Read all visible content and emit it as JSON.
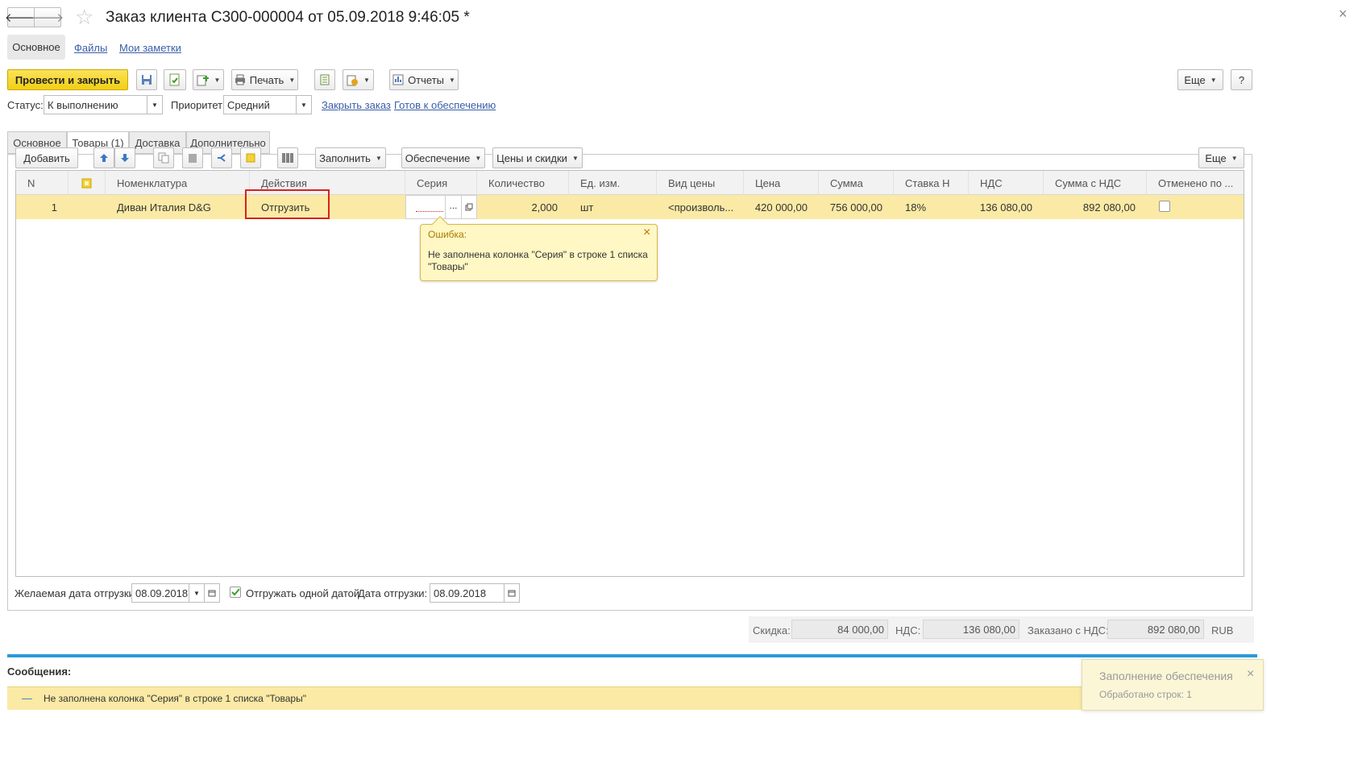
{
  "window": {
    "title": "Заказ клиента С300-000004 от 05.09.2018 9:46:05 *",
    "close_glyph": "×"
  },
  "nav": {
    "back_glyph": "🡐",
    "forward_glyph": "🡒",
    "star_glyph": "☆",
    "sections": [
      "Основное",
      "Файлы",
      "Мои заметки"
    ]
  },
  "toolbar": {
    "post_close_label": "Провести и закрыть",
    "print_label": "Печать",
    "reports_label": "Отчеты",
    "more_label": "Еще",
    "help_label": "?"
  },
  "status_row": {
    "status_label": "Статус:",
    "status_value": "К выполнению",
    "priority_label": "Приоритет:",
    "priority_value": "Средний",
    "close_order_link": "Закрыть заказ",
    "ready_link": "Готов к обеспечению"
  },
  "tabs": [
    "Основное",
    "Товары (1)",
    "Доставка",
    "Дополнительно"
  ],
  "items_toolbar": {
    "add_label": "Добавить",
    "fill_label": "Заполнить",
    "supply_label": "Обеспечение",
    "prices_label": "Цены и скидки",
    "more_label": "Еще"
  },
  "table": {
    "columns": [
      "N",
      "",
      "Номенклатура",
      "Действия",
      "Серия",
      "Количество",
      "Ед. изм.",
      "Вид цены",
      "Цена",
      "Сумма",
      "Ставка Н",
      "НДС",
      "Сумма с НДС",
      "Отменено по ..."
    ],
    "row": {
      "n": "1",
      "nomenclature": "Диван Италия D&G",
      "action": "Отгрузить",
      "series": "",
      "series_btn": "...",
      "quantity": "2,000",
      "unit": "шт",
      "price_type": "<произволь...",
      "price": "420 000,00",
      "sum": "756 000,00",
      "vat_rate": "18%",
      "vat": "136 080,00",
      "sum_with_vat": "892 080,00",
      "cancelled": false
    }
  },
  "error_popup": {
    "title": "Ошибка:",
    "close_glyph": "×",
    "message": "Не заполнена колонка \"Серия\" в строке 1 списка \"Товары\""
  },
  "shipment_row": {
    "desired_date_label": "Желаемая дата отгрузки:",
    "desired_date_value": "08.09.2018",
    "one_date_label": "Отгружать одной датой",
    "one_date_checked": true,
    "ship_date_label": "Дата отгрузки:",
    "ship_date_value": "08.09.2018"
  },
  "totals": {
    "discount_label": "Скидка:",
    "discount_value": "84 000,00",
    "vat_label": "НДС:",
    "vat_value": "136 080,00",
    "ordered_label": "Заказано с НДС:",
    "ordered_value": "892 080,00",
    "currency": "RUB"
  },
  "messages": {
    "header": "Сообщения:",
    "items": [
      {
        "bullet": "—",
        "text": "Не заполнена колонка \"Серия\" в строке 1 списка \"Товары\""
      }
    ]
  },
  "notification": {
    "title": "Заполнение обеспечения",
    "text": "Обработано строк: 1",
    "close_glyph": "×"
  },
  "colors": {
    "accent_yellow": "#f5d51c",
    "row_highlight": "#fbeaa5",
    "popup_bg": "#fff7c4",
    "highlight_border": "#d9201f",
    "link_blue": "#3a5ea8",
    "messages_bar": "#2b9ad8"
  }
}
